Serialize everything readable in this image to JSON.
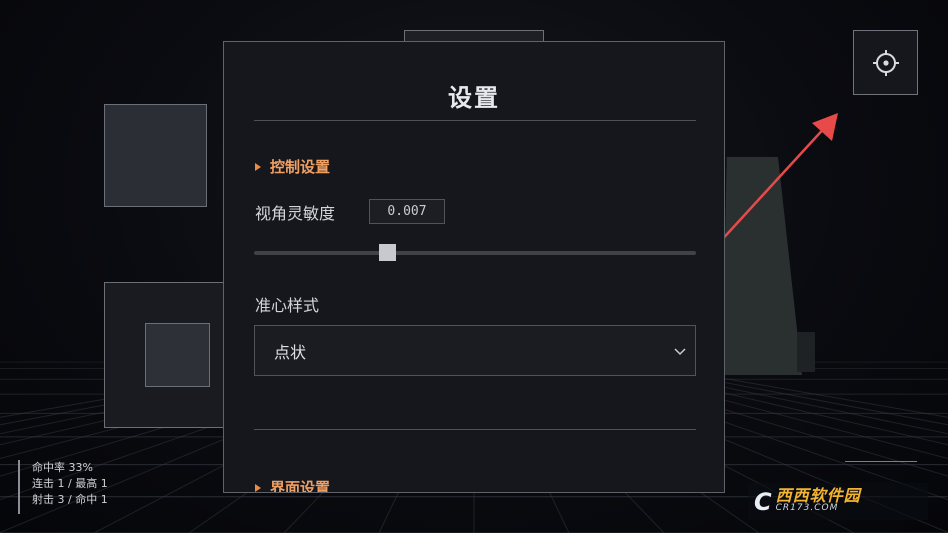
{
  "scene": {
    "background_color": "#07080c",
    "floor_grid_color": "#3a3e47"
  },
  "settings_button": {
    "icon": "crosshair-gear-icon"
  },
  "panel": {
    "title": "设置",
    "control_section": {
      "label": "控制设置",
      "sensitivity": {
        "label": "视角灵敏度",
        "value": "0.007",
        "slider_fraction": 0.3
      },
      "crosshair": {
        "label": "准心样式",
        "selected": "点状"
      }
    },
    "ui_section": {
      "label": "界面设置"
    }
  },
  "hud": {
    "stats": [
      "命中率 33%",
      "连击 1 / 最高 1",
      "射击 3 / 命中 1"
    ]
  },
  "watermark": {
    "logo": "C",
    "brand": "西西软件园",
    "url": "CR173.COM"
  },
  "colors": {
    "accent": "#f0a063",
    "arrow": "#e84a4a"
  }
}
